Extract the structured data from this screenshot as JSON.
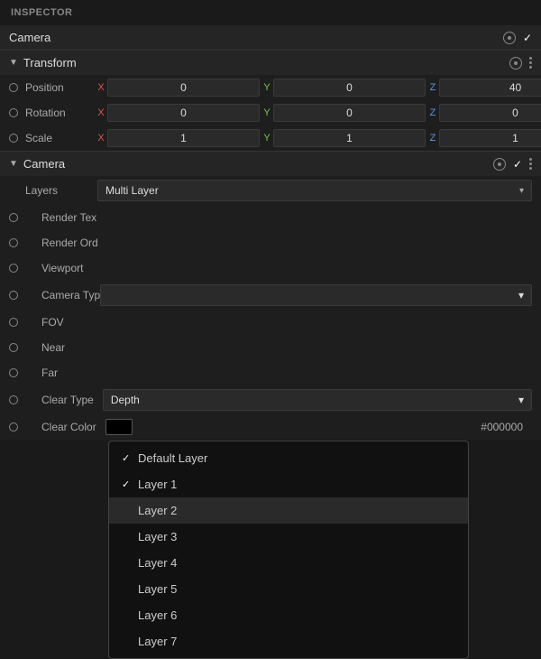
{
  "header": {
    "title": "INSPECTOR"
  },
  "camera_bar": {
    "label": "Camera",
    "icon_circle": true,
    "icon_check": true
  },
  "transform_section": {
    "title": "Transform",
    "position": {
      "label": "Position",
      "x": "0",
      "y": "0",
      "z": "40"
    },
    "rotation": {
      "label": "Rotation",
      "x": "0",
      "y": "0",
      "z": "0"
    },
    "scale": {
      "label": "Scale",
      "x": "1",
      "y": "1",
      "z": "1"
    }
  },
  "camera_section": {
    "title": "Camera",
    "layers": {
      "label": "Layers",
      "value": "Multi Layer"
    },
    "render_texture": {
      "label": "Render Tex"
    },
    "render_order": {
      "label": "Render Ord"
    },
    "viewport": {
      "label": "Viewport"
    },
    "camera_type": {
      "label": "Camera Typ"
    },
    "fov": {
      "label": "FOV"
    },
    "near": {
      "label": "Near"
    },
    "far": {
      "label": "Far"
    },
    "clear_type": {
      "label": "Clear Type",
      "value": "Depth"
    },
    "clear_color": {
      "label": "Clear Color",
      "swatch": "#000000",
      "hex": "#000000"
    }
  },
  "dropdown": {
    "items": [
      {
        "label": "Default Layer",
        "checked": true
      },
      {
        "label": "Layer 1",
        "checked": true
      },
      {
        "label": "Layer 2",
        "checked": false,
        "hovered": true
      },
      {
        "label": "Layer 3",
        "checked": false
      },
      {
        "label": "Layer 4",
        "checked": false
      },
      {
        "label": "Layer 5",
        "checked": false
      },
      {
        "label": "Layer 6",
        "checked": false
      },
      {
        "label": "Layer 7",
        "checked": false
      }
    ]
  }
}
